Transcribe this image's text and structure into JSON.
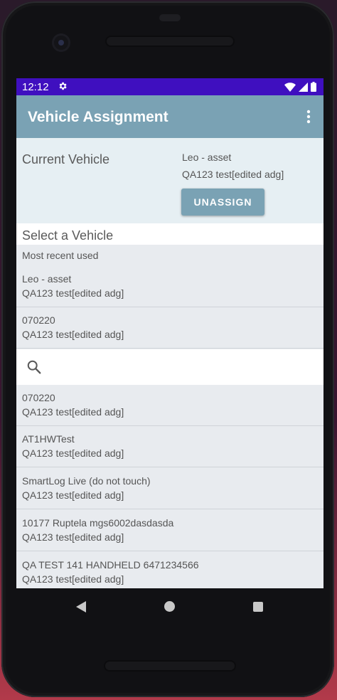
{
  "status_bar": {
    "time": "12:12",
    "icons": [
      "gear-icon",
      "wifi-icon",
      "signal-icon",
      "battery-icon"
    ],
    "color": "#3f0fbf"
  },
  "app_bar": {
    "title": "Vehicle Assignment",
    "menu_icon": "overflow-menu-icon",
    "color": "#7aa2b4"
  },
  "current_vehicle": {
    "label": "Current Vehicle",
    "name": "Leo - asset",
    "subtitle": "QA123 test[edited adg]",
    "unassign_label": "UNASSIGN"
  },
  "select_vehicle": {
    "title": "Select a Vehicle",
    "recent_label": "Most recent used",
    "recent_items": [
      {
        "name": "Leo - asset",
        "subtitle": "QA123 test[edited adg]"
      },
      {
        "name": "070220",
        "subtitle": "QA123 test[edited adg]"
      }
    ],
    "search": {
      "icon": "search-icon",
      "placeholder": ""
    },
    "all_items": [
      {
        "name": "070220",
        "subtitle": "QA123 test[edited adg]"
      },
      {
        "name": "AT1HWTest",
        "subtitle": "QA123 test[edited adg]"
      },
      {
        "name": "SmartLog Live (do not touch)",
        "subtitle": "QA123 test[edited adg]"
      },
      {
        "name": "10177 Ruptela mgs6002dasdasda",
        "subtitle": "QA123 test[edited adg]"
      },
      {
        "name": "QA TEST 141 HANDHELD 6471234566",
        "subtitle": "QA123 test[edited adg]"
      }
    ]
  },
  "nav_bar": {
    "icons": [
      "back-icon",
      "home-icon",
      "recents-icon"
    ]
  }
}
